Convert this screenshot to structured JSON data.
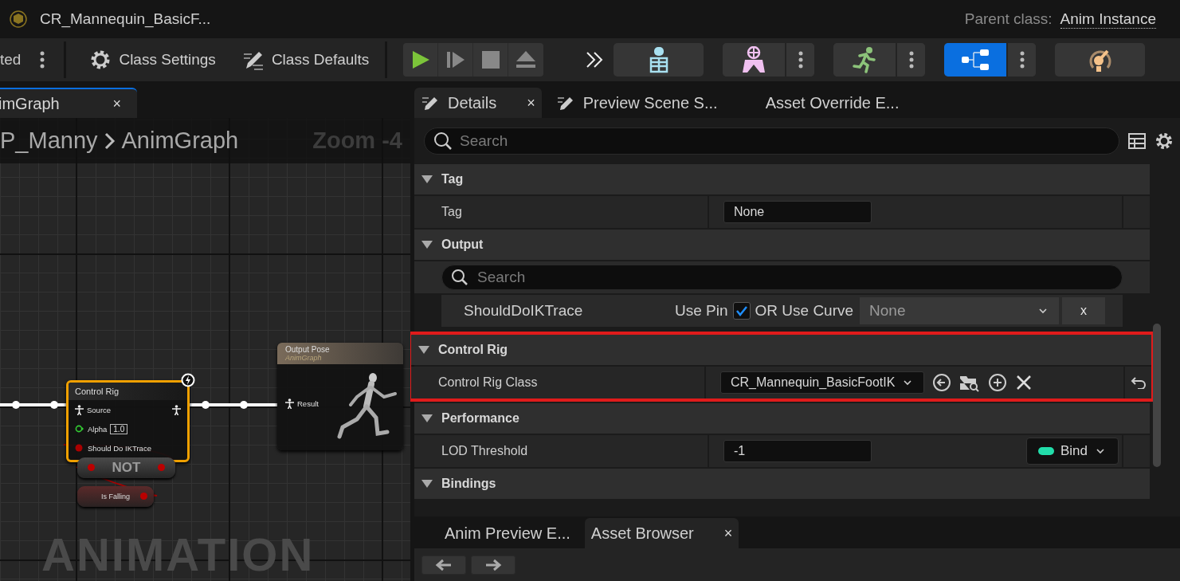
{
  "window": {
    "title": "CR_Mannequin_BasicF...",
    "parent_class_label": "Parent class:",
    "parent_class": "Anim Instance"
  },
  "toolbar": {
    "status_text": "ted",
    "buttons": [
      {
        "label": "Class Settings"
      },
      {
        "label": "Class Defaults"
      }
    ],
    "modes": [
      {
        "selected": false,
        "has_menu": false
      },
      {
        "selected": false,
        "has_menu": true
      },
      {
        "selected": false,
        "has_menu": true
      },
      {
        "selected": true,
        "has_menu": true
      },
      {
        "selected": false,
        "has_menu": false
      }
    ]
  },
  "graph": {
    "tab": {
      "label": "imGraph",
      "close_label": "×"
    },
    "breadcrumb": [
      "P_Manny",
      "AnimGraph"
    ],
    "zoom": "Zoom -4",
    "type_label": "ANIMATION",
    "control_rig_node": {
      "title": "Control Rig",
      "selected": true,
      "pins": [
        {
          "kind": "pose",
          "label": "Source"
        },
        {
          "kind": "float",
          "label": "Alpha",
          "value": "1.0"
        },
        {
          "kind": "bool",
          "label": "Should Do IKTrace"
        }
      ]
    },
    "not_node": {
      "label": "NOT"
    },
    "is_falling_node": {
      "label": "Is Falling"
    },
    "output_node": {
      "title": "Output Pose",
      "subtitle": "AnimGraph",
      "pin": "Result"
    }
  },
  "details": {
    "tabs": [
      {
        "label": "Details",
        "selected": true,
        "close_label": "×"
      },
      {
        "label": "Preview Scene S...",
        "selected": false
      },
      {
        "label": "Asset Override E...",
        "selected": false
      }
    ],
    "search": {
      "placeholder": "Search"
    },
    "sections": [
      {
        "title": "Tag",
        "highlighted": false,
        "rows": [
          {
            "kind": "text",
            "label": "Tag",
            "value": "None"
          }
        ]
      },
      {
        "title": "Output",
        "highlighted": false,
        "rows": [
          {
            "kind": "search",
            "placeholder": "Search"
          },
          {
            "kind": "pin",
            "label": "ShouldDoIKTrace",
            "use_pin_label": "Use Pin",
            "checked": true,
            "curve_label": "OR Use Curve",
            "curve_value": "None",
            "clear_label": "x"
          }
        ]
      },
      {
        "title": "Control Rig",
        "highlighted": true,
        "rows": [
          {
            "kind": "asset",
            "label": "Control Rig Class",
            "value": "CR_Mannequin_BasicFootIK"
          }
        ]
      },
      {
        "title": "Performance",
        "highlighted": false,
        "rows": [
          {
            "kind": "number",
            "label": "LOD Threshold",
            "value": "-1",
            "bind_label": "Bind"
          }
        ]
      },
      {
        "title": "Bindings",
        "highlighted": false
      }
    ]
  },
  "bottom": {
    "tabs": [
      {
        "label": "Anim Preview E...",
        "selected": false
      },
      {
        "label": "Asset Browser",
        "selected": true,
        "close_label": "×"
      }
    ]
  }
}
